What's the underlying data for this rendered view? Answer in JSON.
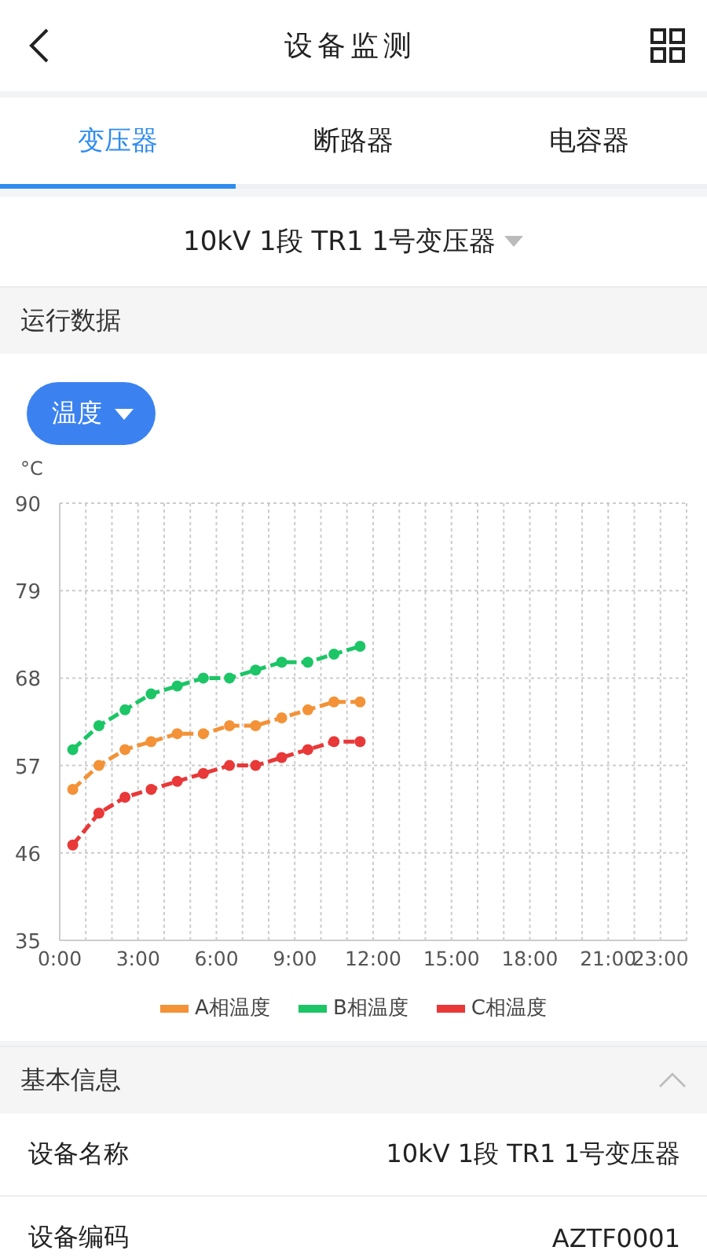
{
  "header": {
    "title": "设备监测"
  },
  "tabs": [
    {
      "label": "变压器",
      "selected": true
    },
    {
      "label": "断路器",
      "selected": false
    },
    {
      "label": "电容器",
      "selected": false
    }
  ],
  "device_selector": {
    "value": "10kV 1段 TR1 1号变压器"
  },
  "running_data": {
    "title": "运行数据",
    "metric_button": "温度",
    "unit": "°C",
    "chart_data": {
      "type": "line",
      "x": [
        0.5,
        1.5,
        2.5,
        3.5,
        4.5,
        5.5,
        6.5,
        7.5,
        8.5,
        9.5,
        10.5,
        11.5
      ],
      "xlim": [
        0,
        24
      ],
      "ylim": [
        35,
        90
      ],
      "xticks": [
        {
          "value": 0,
          "label": "0:00"
        },
        {
          "value": 3,
          "label": "3:00"
        },
        {
          "value": 6,
          "label": "6:00"
        },
        {
          "value": 9,
          "label": "9:00"
        },
        {
          "value": 12,
          "label": "12:00"
        },
        {
          "value": 15,
          "label": "15:00"
        },
        {
          "value": 18,
          "label": "18:00"
        },
        {
          "value": 21,
          "label": "21:00"
        },
        {
          "value": 23,
          "label": "23:00"
        }
      ],
      "yticks": [
        35,
        46,
        57,
        68,
        79,
        90
      ],
      "grid": true,
      "series": [
        {
          "name": "A相温度",
          "color": "#f39237",
          "marker": true,
          "line_style": "dashed",
          "values": [
            54,
            57,
            59,
            60,
            61,
            61,
            62,
            62,
            63,
            64,
            65,
            65
          ]
        },
        {
          "name": "B相温度",
          "color": "#1cc566",
          "marker": true,
          "line_style": "dashed",
          "values": [
            59,
            62,
            64,
            66,
            67,
            68,
            68,
            69,
            70,
            70,
            71,
            72
          ]
        },
        {
          "name": "C相温度",
          "color": "#e83838",
          "marker": true,
          "line_style": "dashed",
          "values": [
            47,
            51,
            53,
            54,
            55,
            56,
            57,
            57,
            58,
            59,
            60,
            60
          ]
        }
      ]
    }
  },
  "basic_info": {
    "title": "基本信息",
    "expanded": true,
    "rows": [
      {
        "label": "设备名称",
        "value": "10kV 1段 TR1 1号变压器"
      },
      {
        "label": "设备编码",
        "value": "AZTF0001"
      }
    ]
  }
}
